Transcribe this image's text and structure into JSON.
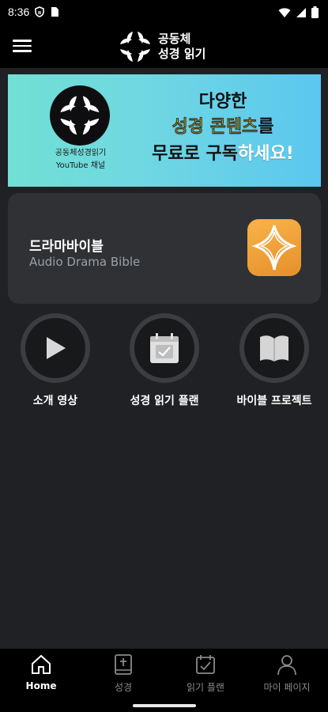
{
  "status_bar": {
    "time": "8:36",
    "icons": [
      "shield-icon",
      "sim-card-icon",
      "wifi-icon",
      "signal-icon",
      "battery-icon"
    ]
  },
  "header": {
    "logo_line1": "공동체",
    "logo_line2": "성경 읽기",
    "menu_icon": "hamburger-menu-icon"
  },
  "banner": {
    "channel_line1": "공동체성경읽기",
    "channel_line2": "YouTube 채널",
    "headline_line1": "다양한",
    "headline_line2_highlight": "성경 콘텐츠",
    "headline_line2_rest": "를",
    "headline_line3_a": "무료로 구독",
    "headline_line3_b": "하세요!",
    "colors": {
      "highlight": "#fff200",
      "gradient_start": "#71e0d4",
      "gradient_end": "#5bc7ef"
    }
  },
  "drama_card": {
    "title": "드라마바이블",
    "subtitle": "Audio Drama Bible",
    "icon_color": "#f4a63a"
  },
  "quick_buttons": [
    {
      "label": "소개 영상",
      "icon": "play-icon"
    },
    {
      "label": "성경 읽기 플랜",
      "icon": "calendar-check-icon"
    },
    {
      "label": "바이블 프로젝트",
      "icon": "map-book-icon"
    }
  ],
  "bottom_nav": [
    {
      "label": "Home",
      "icon": "home-icon",
      "active": true
    },
    {
      "label": "성경",
      "icon": "bible-icon",
      "active": false
    },
    {
      "label": "읽기 플랜",
      "icon": "calendar-check-icon",
      "active": false
    },
    {
      "label": "마이 페이지",
      "icon": "person-icon",
      "active": false
    }
  ]
}
